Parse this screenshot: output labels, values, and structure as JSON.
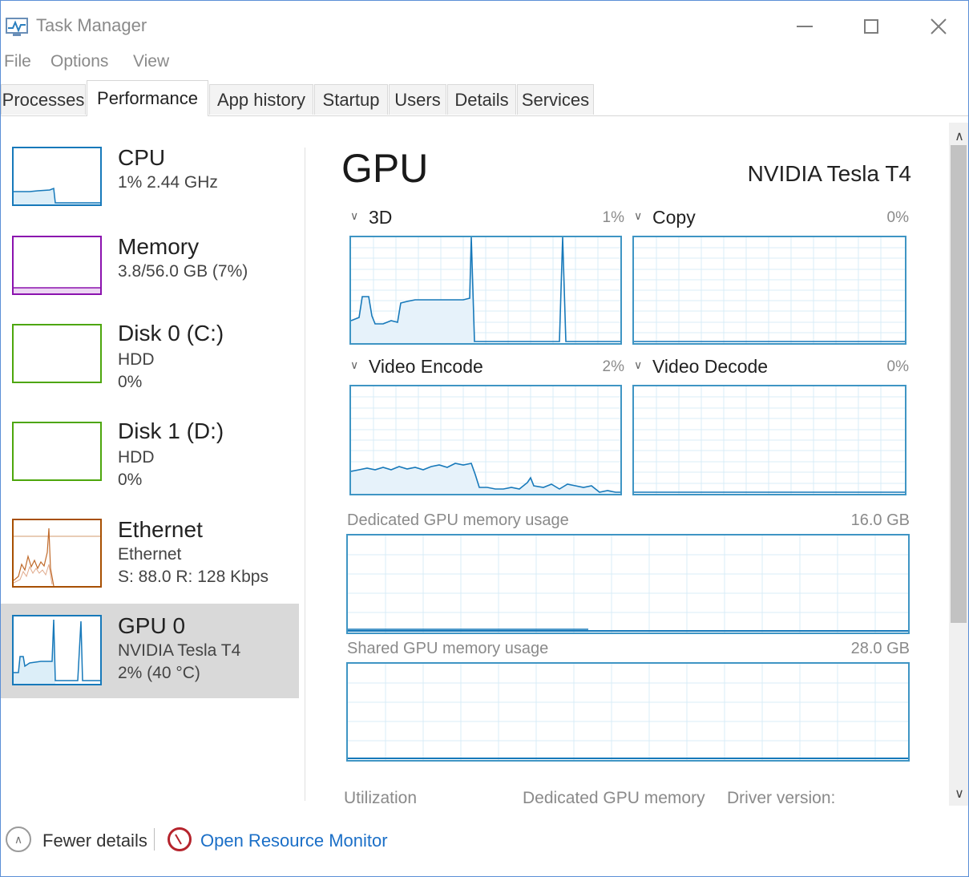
{
  "window": {
    "title": "Task Manager"
  },
  "menu": [
    "File",
    "Options",
    "View"
  ],
  "tabs": [
    "Processes",
    "Performance",
    "App history",
    "Startup",
    "Users",
    "Details",
    "Services"
  ],
  "active_tab": "Performance",
  "sidebar": [
    {
      "name": "CPU",
      "line1": "1% 2.44 GHz",
      "line2": "",
      "color": "#1779ba"
    },
    {
      "name": "Memory",
      "line1": "3.8/56.0 GB (7%)",
      "line2": "",
      "color": "#8b12ae"
    },
    {
      "name": "Disk 0 (C:)",
      "line1": "HDD",
      "line2": "0%",
      "color": "#4da60c"
    },
    {
      "name": "Disk 1 (D:)",
      "line1": "HDD",
      "line2": "0%",
      "color": "#4da60c"
    },
    {
      "name": "Ethernet",
      "line1": "Ethernet",
      "line2": "S: 88.0 R: 128 Kbps",
      "color": "#a74f01"
    },
    {
      "name": "GPU 0",
      "line1": "NVIDIA Tesla T4",
      "line2": "2% (40 °C)",
      "color": "#1779ba"
    }
  ],
  "main": {
    "title": "GPU",
    "model": "NVIDIA Tesla T4",
    "engines": [
      {
        "label": "3D",
        "percent": "1%"
      },
      {
        "label": "Copy",
        "percent": "0%"
      },
      {
        "label": "Video Encode",
        "percent": "2%"
      },
      {
        "label": "Video Decode",
        "percent": "0%"
      }
    ],
    "dedicated_label": "Dedicated GPU memory usage",
    "dedicated_max": "16.0 GB",
    "shared_label": "Shared GPU memory usage",
    "shared_max": "28.0 GB",
    "stats": [
      "Utilization",
      "Dedicated GPU memory",
      "Driver version:"
    ]
  },
  "footer": {
    "fewer_details": "Fewer details",
    "resource_monitor": "Open Resource Monitor"
  },
  "accent": "#1b6fc7",
  "graph_color": "#3f95c4"
}
